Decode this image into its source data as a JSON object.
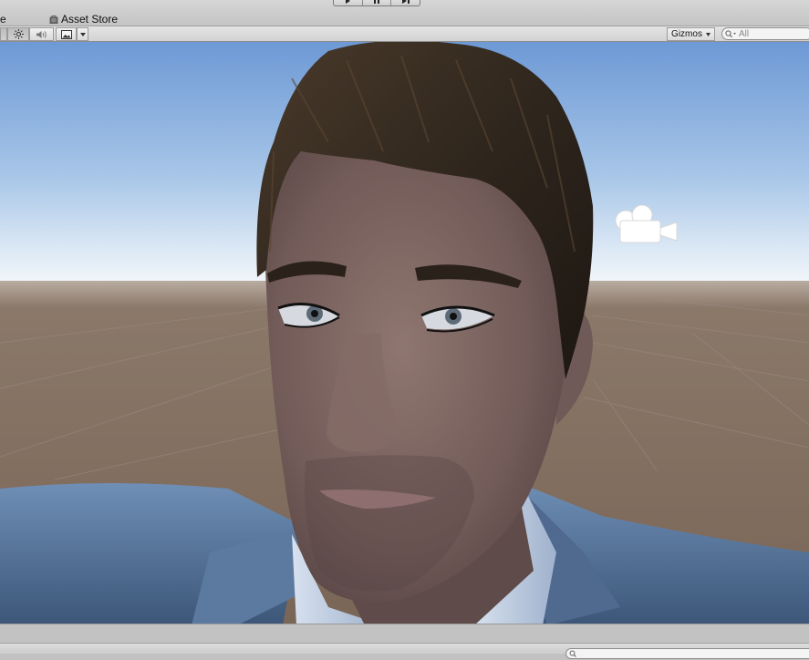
{
  "tabs": {
    "prev_tab_fragment": "e",
    "asset_store_label": "Asset Store",
    "asset_store_icon": "asset-store-bag-icon"
  },
  "play_controls": {
    "play_icon": "play-icon",
    "pause_icon": "pause-icon",
    "step_icon": "step-icon"
  },
  "scene_toolbar": {
    "lighting_icon": "sun-icon",
    "audio_icon": "speaker-icon",
    "effects_icon": "image-icon",
    "gizmos_label": "Gizmos",
    "search_placeholder": "All"
  },
  "viewport": {
    "scene_gizmo_icon": "camera-icon",
    "sky_color_top": "#6e9ad6",
    "horizon_color": "#f4f8fb",
    "ground_color": "#7d6a5c"
  }
}
